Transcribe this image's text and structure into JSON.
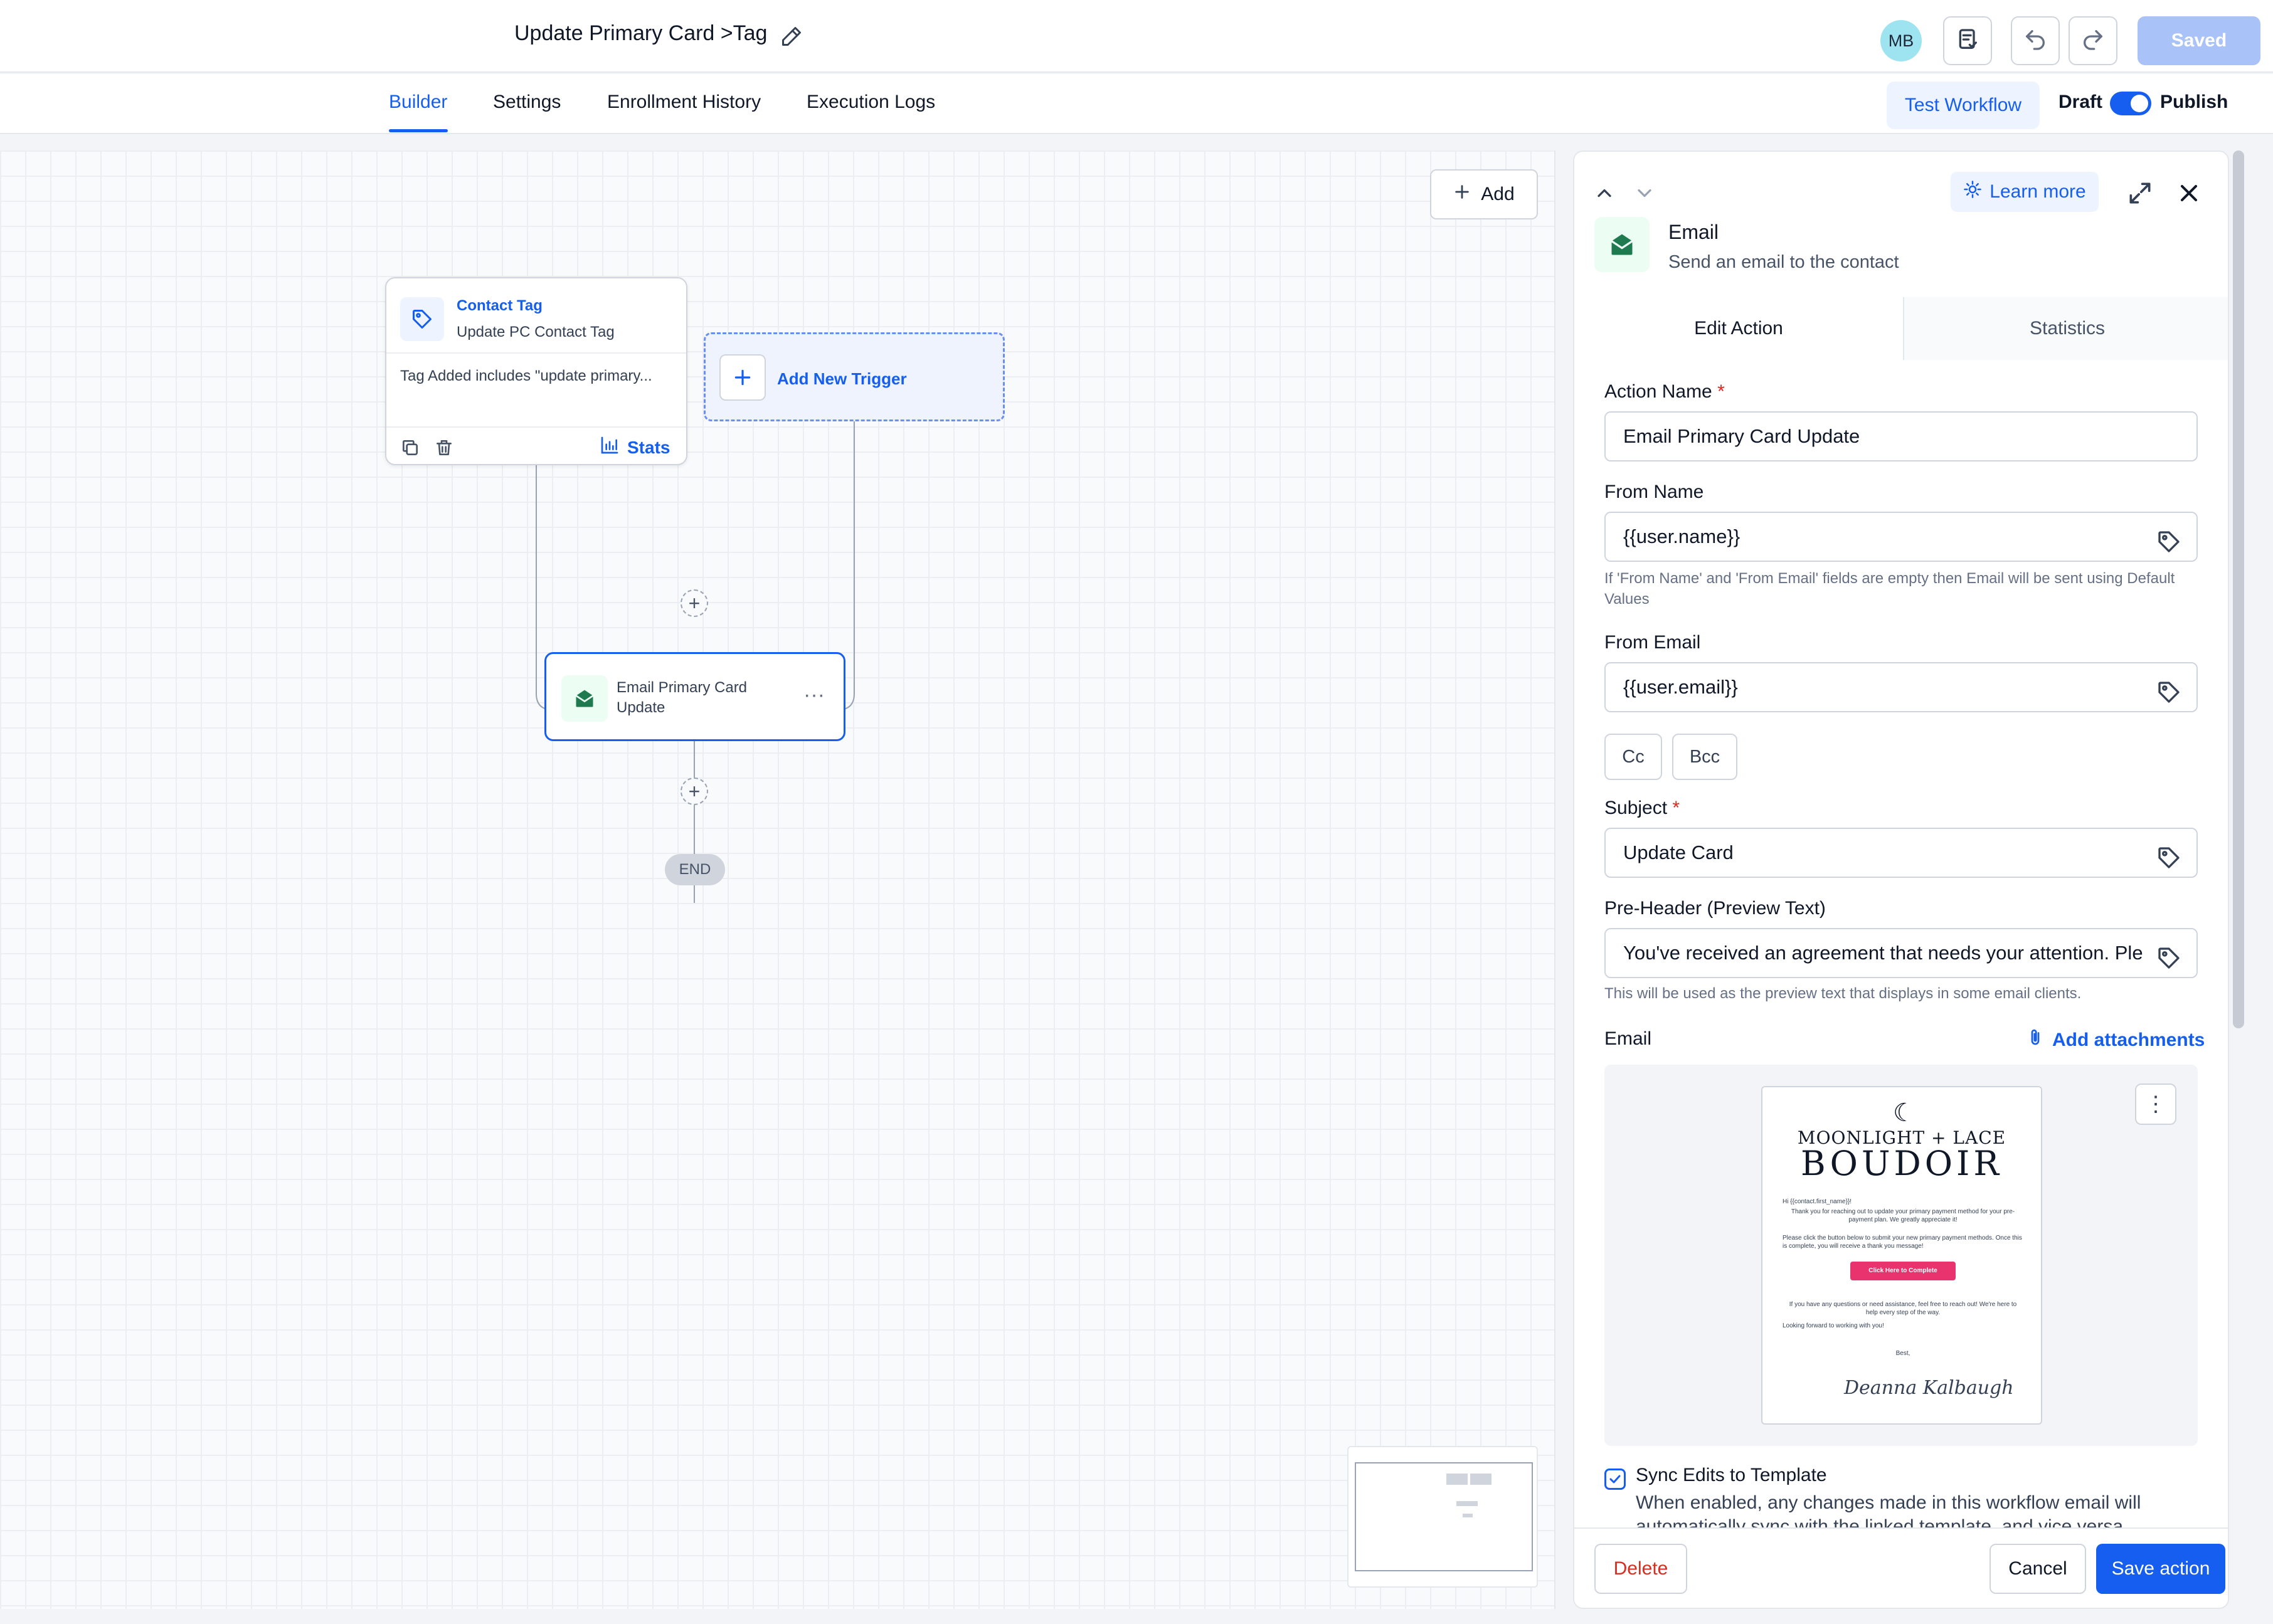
{
  "header": {
    "title": "Update Primary Card >Tag",
    "avatar_initials": "MB",
    "saved_label": "Saved"
  },
  "tabs": [
    "Builder",
    "Settings",
    "Enrollment History",
    "Execution Logs"
  ],
  "tabs_active": "Builder",
  "toolbar": {
    "test_workflow": "Test Workflow",
    "draft": "Draft",
    "publish": "Publish",
    "publish_toggle_on": true
  },
  "canvas": {
    "add_label": "Add",
    "trigger": {
      "title": "Contact Tag",
      "subtitle": "Update PC Contact Tag",
      "description": "Tag Added includes \"update primary...",
      "stats_label": "Stats"
    },
    "new_trigger_label": "Add New Trigger",
    "action_label": "Email Primary Card Update",
    "end_label": "END"
  },
  "panel": {
    "learn_more": "Learn more",
    "title": "Email",
    "subtitle": "Send an email to the contact",
    "tab_edit": "Edit Action",
    "tab_stats": "Statistics",
    "action_name_label": "Action Name",
    "action_name_value": "Email Primary Card Update",
    "from_name_label": "From Name",
    "from_name_value": "{{user.name}}",
    "from_hint": "If 'From Name' and 'From Email' fields are empty then Email will be sent using Default Values",
    "from_email_label": "From Email",
    "from_email_value": "{{user.email}}",
    "cc_label": "Cc",
    "bcc_label": "Bcc",
    "subject_label": "Subject",
    "subject_value": "Update Card",
    "preheader_label": "Pre-Header (Preview Text)",
    "preheader_value": "You've received an agreement that needs your attention. Ple",
    "preheader_hint": "This will be used as the preview text that displays in some email clients.",
    "email_label": "Email",
    "add_attachments": "Add attachments",
    "sync_checked": true,
    "sync_title": "Sync Edits to Template",
    "sync_desc": "When enabled, any changes made in this workflow email will automatically sync with the linked template, and vice versa.",
    "delete_label": "Delete",
    "cancel_label": "Cancel",
    "save_label": "Save action"
  },
  "email_preview": {
    "brand_line1": "MOONLIGHT + LACE",
    "brand_line2": "BOUDOIR",
    "greeting": "Hi {{contact.first_name}}!",
    "para1": "Thank you for reaching out to update your primary payment method for your pre-payment plan. We greatly appreciate it!",
    "para2": "Please click the button below to submit your new primary payment methods. Once this is complete, you will receive a thank you message!",
    "cta": "Click Here to Complete",
    "para3": "If you have any questions or need assistance, feel free to reach out! We're here to help every step of the way.",
    "para4": "Looking forward to working with you!",
    "signoff": "Best,",
    "signature": "Deanna Kalbaugh"
  },
  "colors": {
    "primary": "#155eef",
    "danger": "#d92d20",
    "email_icon": "#1f7a4f",
    "cta": "#e8336e"
  }
}
